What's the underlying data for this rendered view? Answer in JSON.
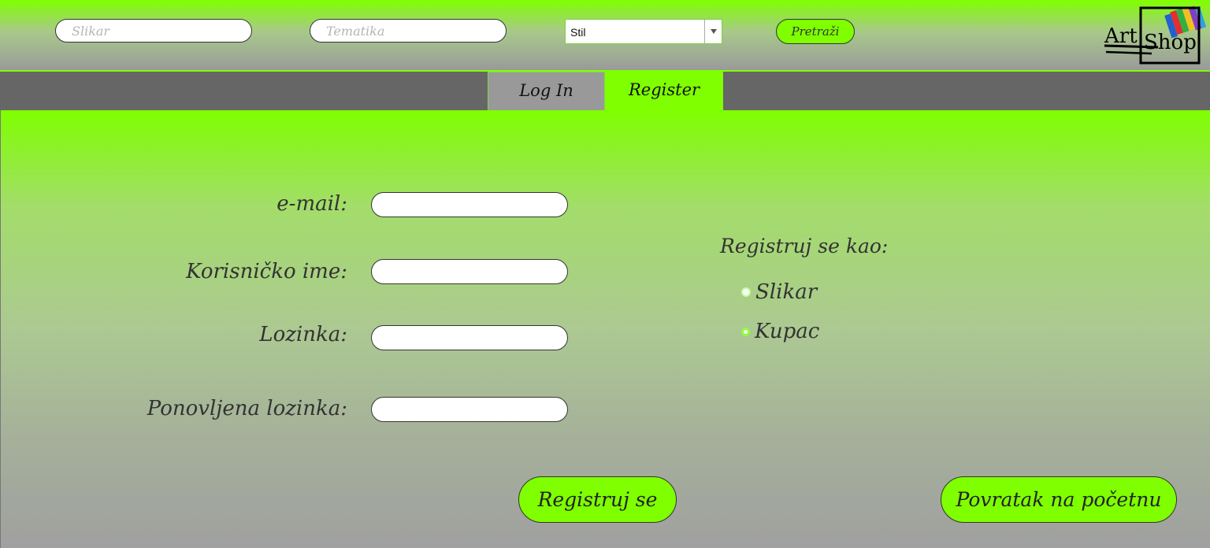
{
  "search": {
    "painter_placeholder": "Slikar",
    "theme_placeholder": "Tematika",
    "style_select_value": "Stil",
    "search_button": "Pretraži"
  },
  "logo": {
    "word1": "Art",
    "word2": "Shop"
  },
  "tabs": {
    "login": "Log In",
    "register": "Register"
  },
  "form": {
    "email_label": "e-mail:",
    "username_label": "Korisničko ime:",
    "password_label": "Lozinka:",
    "repeat_password_label": "Ponovljena lozinka:",
    "email_value": "",
    "username_value": "",
    "password_value": "",
    "repeat_password_value": ""
  },
  "role": {
    "title": "Registruj se kao:",
    "options": [
      {
        "label": "Slikar",
        "selected": true
      },
      {
        "label": "Kupac",
        "selected": false
      }
    ]
  },
  "buttons": {
    "register": "Registruj se",
    "back_home": "Povratak na početnu"
  },
  "colors": {
    "accent_green": "#7fff00",
    "tab_bar_gray": "#666666",
    "inactive_tab_gray": "#999999"
  }
}
